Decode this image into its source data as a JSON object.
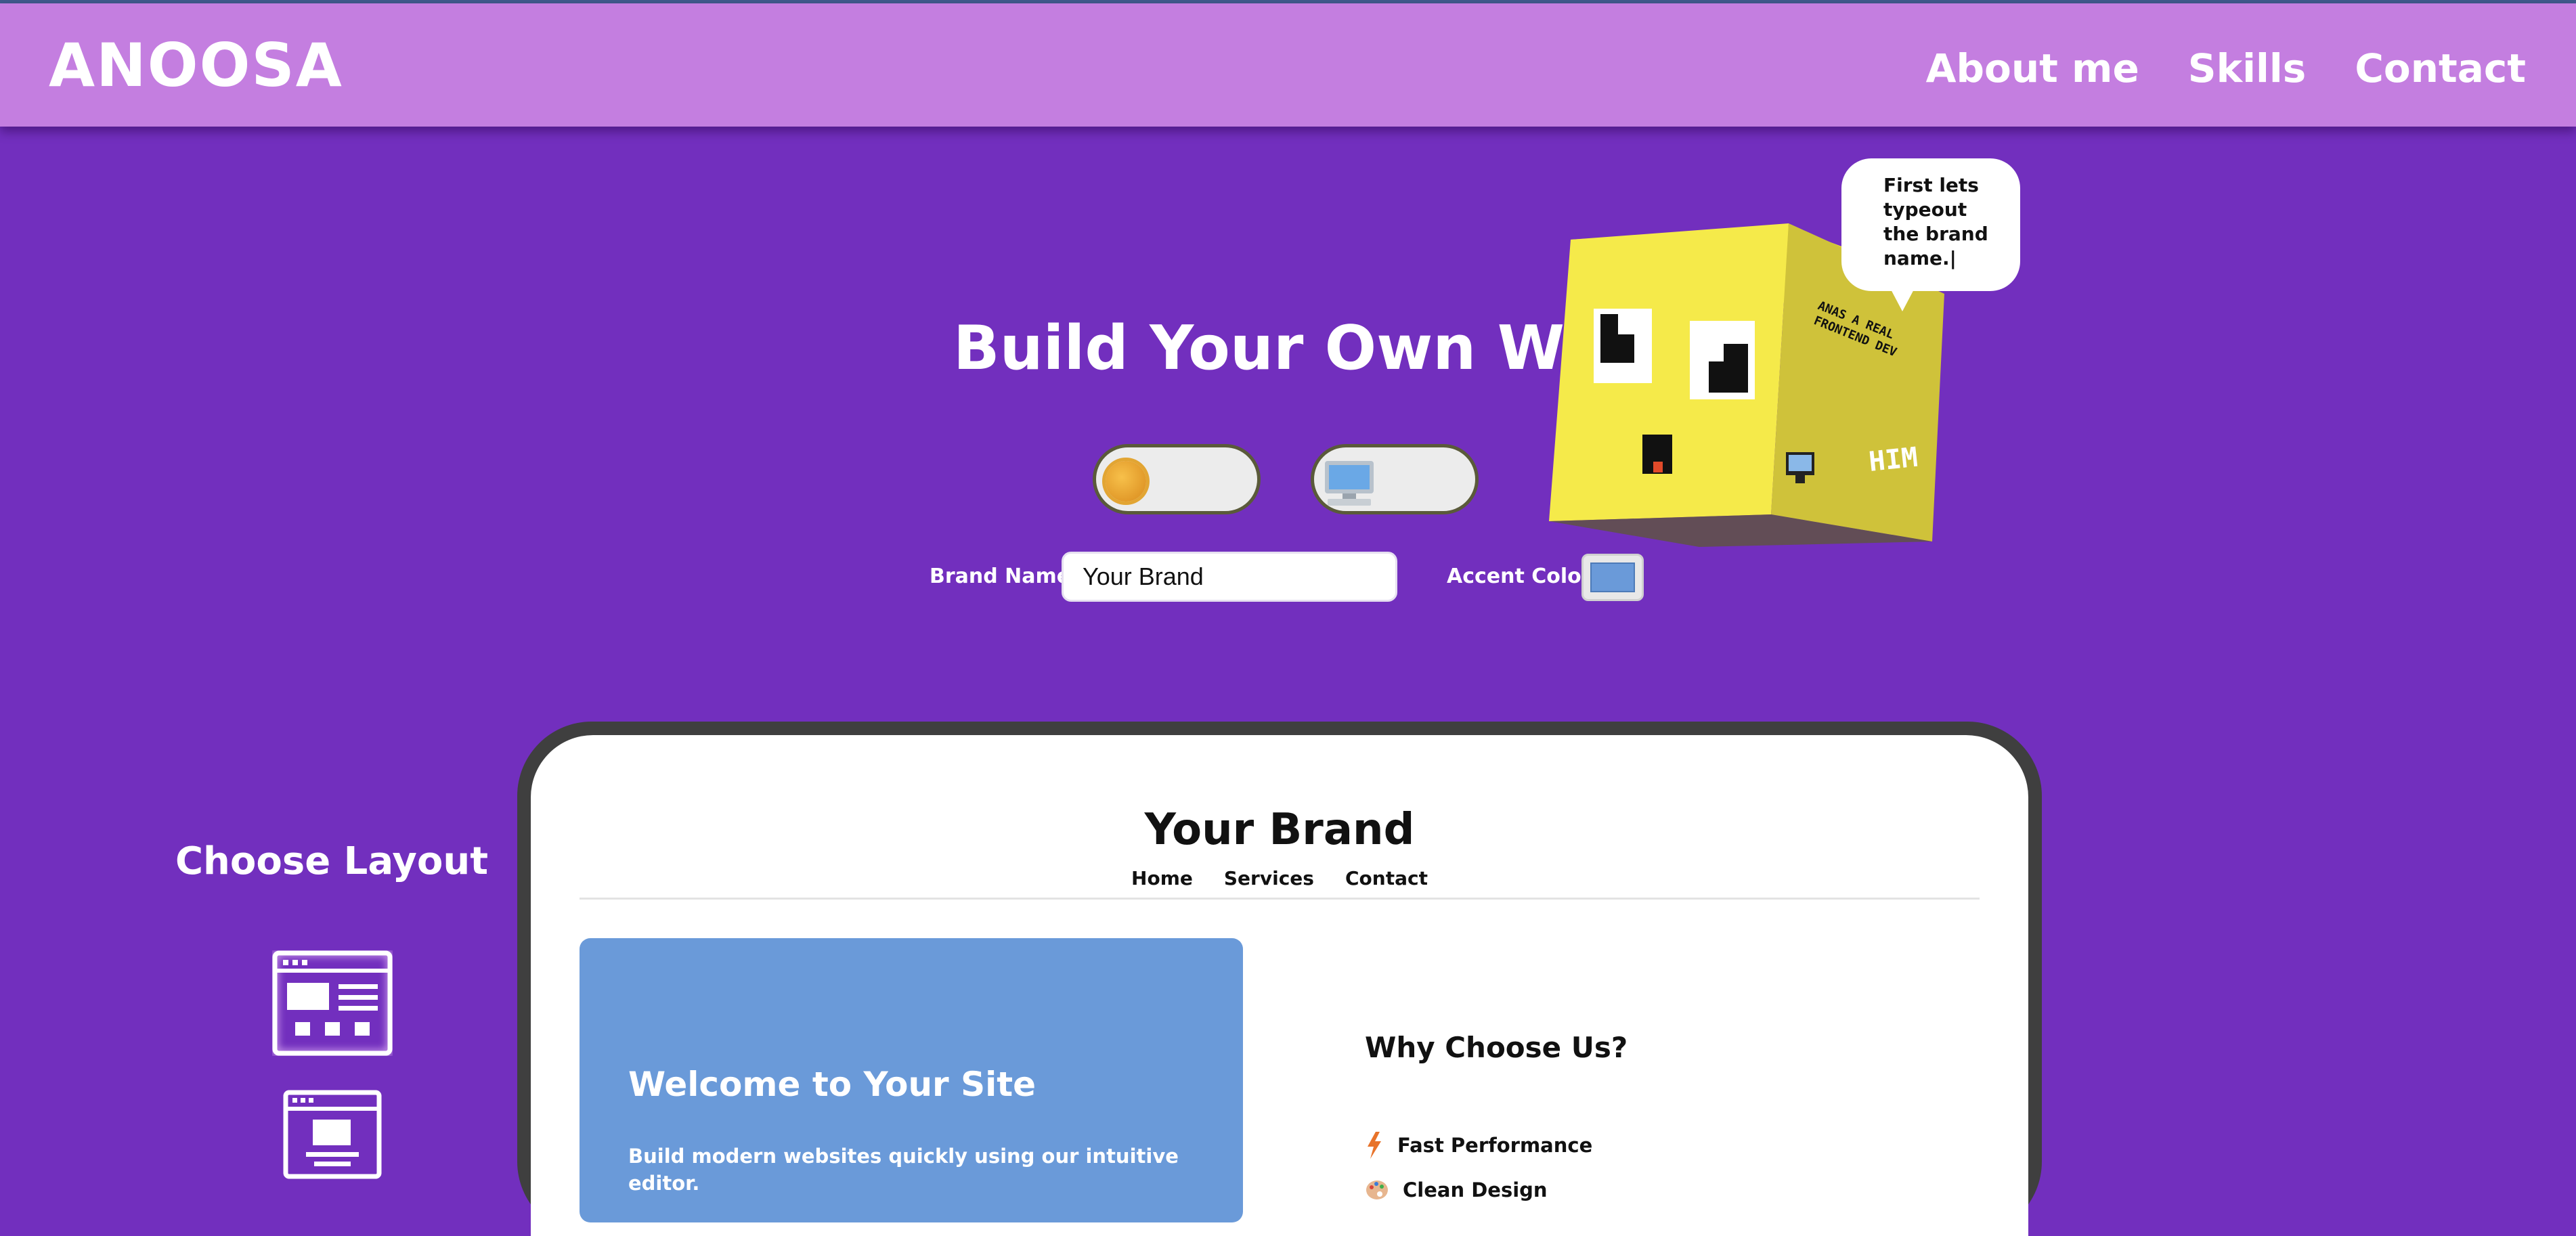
{
  "header": {
    "logo": "ANOOSA",
    "nav": [
      "About me",
      "Skills",
      "Contact"
    ]
  },
  "hero": {
    "title": "Build Your Own Website"
  },
  "toggles": {
    "theme_icon": "sun-icon",
    "device_icon": "desktop-monitor-icon"
  },
  "form": {
    "brand_label": "Brand Name:",
    "brand_value": "Your Brand",
    "accent_label": "Accent Color:",
    "accent_color": "#6a9ad9"
  },
  "mascot": {
    "bubble_text": "First lets typeout the brand name.|",
    "cube_side_text_1": "ANAS A REAL",
    "cube_side_text_2": "FRONTEND DEV",
    "cube_side_text_3": "HIM",
    "cube_color": "#f5ea4a"
  },
  "layout_panel": {
    "title": "Choose Layout",
    "options": [
      "layout-grid-icon",
      "layout-centered-icon"
    ]
  },
  "preview": {
    "brand": "Your Brand",
    "nav": [
      "Home",
      "Services",
      "Contact"
    ],
    "hero_title": "Welcome to Your Site",
    "hero_text": "Build modern websites quickly using our intuitive editor.",
    "why_title": "Why Choose Us?",
    "features": [
      {
        "icon": "lightning-icon",
        "label": "Fast Performance"
      },
      {
        "icon": "palette-icon",
        "label": "Clean Design"
      }
    ]
  },
  "colors": {
    "background": "#722fbe",
    "header": "#c47ee0",
    "accent": "#6a9ad9"
  }
}
